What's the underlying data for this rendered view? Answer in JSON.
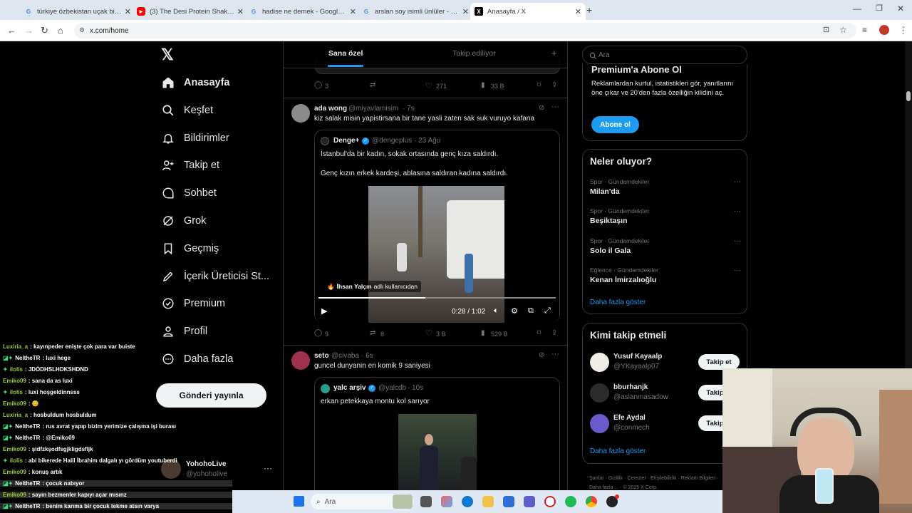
{
  "browser": {
    "tabs": [
      {
        "title": "türkiye özbekistan uçak bileti -",
        "favicon": "G",
        "color": "#4285f4"
      },
      {
        "title": "(3) The Desi Protein Shake of In",
        "favicon": "▶",
        "color": "#ff0000"
      },
      {
        "title": "hadise ne demek - Google'da A",
        "favicon": "G",
        "color": "#4285f4"
      },
      {
        "title": "arslan soy isimli ünlüler - Goog",
        "favicon": "G",
        "color": "#4285f4"
      },
      {
        "title": "Anasayfa / X",
        "favicon": "X",
        "color": "#000000"
      }
    ],
    "new_tab": "+",
    "url": "x.com/home"
  },
  "nav": {
    "logo": "𝕏",
    "items": [
      {
        "label": "Anasayfa",
        "icon": "home-icon"
      },
      {
        "label": "Keşfet",
        "icon": "search-icon"
      },
      {
        "label": "Bildirimler",
        "icon": "bell-icon"
      },
      {
        "label": "Takip et",
        "icon": "person-plus-icon"
      },
      {
        "label": "Sohbet",
        "icon": "chat-icon"
      },
      {
        "label": "Grok",
        "icon": "grok-icon"
      },
      {
        "label": "Geçmiş",
        "icon": "bookmark-icon"
      },
      {
        "label": "İçerik Üreticisi St...",
        "icon": "rocket-icon"
      },
      {
        "label": "Premium",
        "icon": "verified-icon"
      },
      {
        "label": "Profil",
        "icon": "person-icon"
      },
      {
        "label": "Daha fazla",
        "icon": "more-circle-icon"
      }
    ],
    "post_button": "Gönderi yayınla",
    "account": {
      "name": "YohohoLive",
      "handle": "@yohoholive"
    }
  },
  "feed": {
    "tabs": [
      "Sana özel",
      "Takip ediliyor"
    ],
    "top_actions": {
      "replies": "3",
      "reposts": "",
      "likes": "271",
      "views": "33 B"
    },
    "posts": [
      {
        "name": "ada wong",
        "handle": "@miyavlamisim",
        "time": "· 7s",
        "text": "kiz salak misin yapistirsana bir tane yasli zaten sak suk vuruyo kafana",
        "quote": {
          "name": "Denge+",
          "handle": "@dengeplus",
          "time": "· 23 Ağu",
          "text1": "İstanbul'da bir kadın, sokak ortasında genç kıza saldırdı.",
          "text2": "Genç kızın erkek kardeşi, ablasına saldıran kadına saldırdı.",
          "video_credit_name": "İhsan Yalçın",
          "video_credit_suffix": "adlı kullanıcıdan",
          "video_time": "0:28 / 1:02",
          "video_progress": 0.45
        },
        "actions": {
          "replies": "9",
          "reposts": "8",
          "likes": "3 B",
          "views": "529 B"
        }
      },
      {
        "name": "seto",
        "handle": "@civaba",
        "time": "· 6s",
        "text": "guncel dunyanin en komik 9 saniyesi",
        "quote": {
          "name": "yalc arşiv",
          "handle": "@yalcdb",
          "time": "· 10s",
          "text1": "erkan petekkaya montu kol sarıyor"
        }
      }
    ]
  },
  "right": {
    "search_placeholder": "Ara",
    "premium": {
      "title": "Premium'a Abone Ol",
      "text": "Reklamlardan kurtul, istatistikleri gör, yanıtlarını öne çıkar ve 20'den fazla özelliğin kilidini aç.",
      "button": "Abone ol"
    },
    "trends_title": "Neler oluyor?",
    "trends": [
      {
        "category": "Spor · Gündemdekiler",
        "name": "Milan'da"
      },
      {
        "category": "Spor · Gündemdekiler",
        "name": "Beşiktaşın"
      },
      {
        "category": "Spor · Gündemdekiler",
        "name": "Solo il Gala"
      },
      {
        "category": "Eğlence · Gündemdekiler",
        "name": "Kenan İmirzalıoğlu"
      }
    ],
    "show_more": "Daha fazla göster",
    "who_title": "Kimi takip etmeli",
    "who": [
      {
        "name": "Yusuf Kayaalp",
        "handle": "@YKayaalp07",
        "button": "Takip et"
      },
      {
        "name": "bburhanjk",
        "handle": "@aslanmasadow",
        "button": "Takip et"
      },
      {
        "name": "Efe Aydal",
        "handle": "@conmech",
        "button": "Takip et"
      }
    ],
    "show_more2": "Daha fazla göster",
    "footer": [
      "Şartlar",
      "Gizlilik",
      "Çerezler",
      "Erişilebilirlik",
      "Reklam Bilgileri",
      "Daha fazla ...",
      "© 2025 X Corp."
    ]
  },
  "chat": [
    {
      "user": "Luxiria_a",
      "msg": ": kayınpeder enişte çok para var buiste",
      "color": "#9acd32",
      "badge": ""
    },
    {
      "user": "NeltheTR",
      "msg": ": luxi hege",
      "color": "#ffffff",
      "badge": "◪✦"
    },
    {
      "user": "ilolis",
      "msg": ": JDÖDHSLHDKSHDND",
      "color": "#9acd32",
      "badge": "✦"
    },
    {
      "user": "Emiko09",
      "msg": ": sana da as luxi",
      "color": "#9acd32",
      "badge": ""
    },
    {
      "user": "ilolis",
      "msg": ": luxi hoşgeldinnsss",
      "color": "#9acd32",
      "badge": "✦"
    },
    {
      "user": "Emiko09",
      "msg": ": 😊",
      "color": "#9acd32",
      "badge": ""
    },
    {
      "user": "Luxiria_a",
      "msg": ": hosbuldum hosbuldum",
      "color": "#9acd32",
      "badge": ""
    },
    {
      "user": "NeltheTR",
      "msg": ": rus avrat yapıp bizim yerimize çalışma işi burası",
      "color": "#ffffff",
      "badge": "◪✦"
    },
    {
      "user": "NeltheTR",
      "msg": ": @Emiko09",
      "color": "#ffffff",
      "badge": "◪✦"
    },
    {
      "user": "Emiko09",
      "msg": ": şidfzkşodfsgjkligdsfljk",
      "color": "#9acd32",
      "badge": ""
    },
    {
      "user": "ilolis",
      "msg": ": abi bikerede Halil İbrahim dalgalı yı gördüm youtuberdi",
      "color": "#9acd32",
      "badge": "✦"
    },
    {
      "user": "Emiko09",
      "msg": ": konuş artık",
      "color": "#9acd32",
      "badge": ""
    },
    {
      "user": "NeltheTR",
      "msg": ": çocuk nabıyor",
      "color": "#ffffff",
      "badge": "◪✦"
    },
    {
      "user": "Emiko09",
      "msg": ": sayın bezmenler kapıyı açar mısınz",
      "color": "#9acd32",
      "badge": ""
    },
    {
      "user": "NeltheTR",
      "msg": ": benim karıma bir çocuk tekme atsın varya",
      "color": "#ffffff",
      "badge": "◪✦"
    }
  ],
  "taskbar": {
    "search_placeholder": "Ara"
  }
}
